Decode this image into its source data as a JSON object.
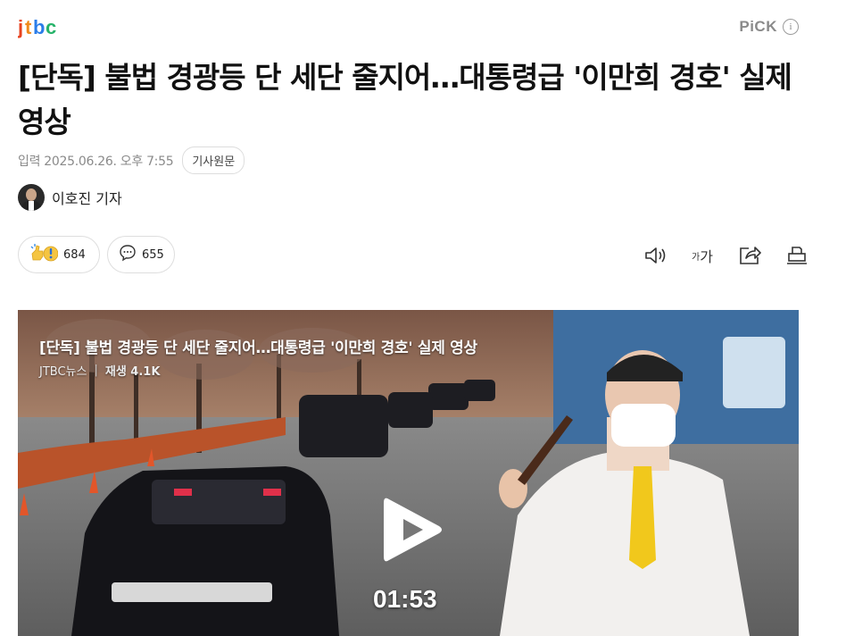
{
  "header": {
    "logo_text": "jtbc",
    "pick_label": "PiCK",
    "pick_info_icon": "i"
  },
  "article": {
    "title": "[단독] 불법 경광등 단 세단 줄지어…대통령급 '이만희 경호' 실제 영상",
    "date_text": "입력 2025.06.26. 오후 7:55",
    "origin_button": "기사원문",
    "reporter_name": "이호진 기자"
  },
  "reactions": {
    "react_count": "684",
    "comment_count": "655"
  },
  "tools": {
    "font_size_small": "가",
    "font_size_large": "가"
  },
  "video": {
    "title": "[단독] 불법 경광등 단 세단 줄지어…대통령급 '이만희 경호' 실제 영상",
    "source": "JTBC뉴스",
    "separator": "|",
    "views": "재생 4.1K",
    "duration": "01:53"
  },
  "colors": {
    "logo_j": "#e8431f",
    "logo_t": "#f08a1c",
    "logo_b": "#2b7de9",
    "logo_c": "#27b36a",
    "pick": "#8a8a8a"
  }
}
